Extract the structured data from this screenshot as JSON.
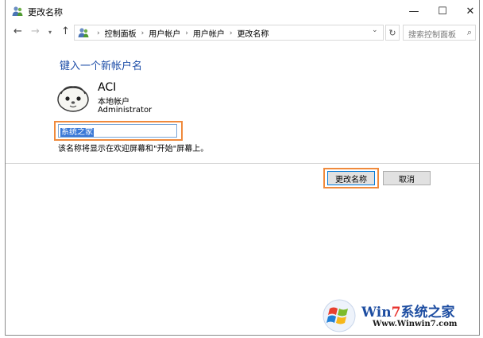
{
  "window": {
    "title": "更改名称",
    "controls": {
      "minimize": "—",
      "maximize": "☐",
      "close": "✕"
    }
  },
  "nav": {
    "back": "←",
    "forward": "→",
    "recent": "▾",
    "up": "↑",
    "breadcrumbs": [
      "控制面板",
      "用户帐户",
      "用户帐户",
      "更改名称"
    ],
    "separator": "›",
    "address_dropdown": "⌄",
    "refresh": "↻",
    "search_placeholder": "搜索控制面板",
    "search_icon": "⌕"
  },
  "content": {
    "heading": "键入一个新帐户名",
    "account": {
      "name": "ACI",
      "type": "本地帐户",
      "group": "Administrator"
    },
    "new_name_value": "系统之家",
    "hint": "该名称将显示在欢迎屏幕和\"开始\"屏幕上。"
  },
  "buttons": {
    "rename": "更改名称",
    "cancel": "取消"
  },
  "watermark": {
    "brand_part1": "Win",
    "brand_part2": "7",
    "brand_part3": "系统之家",
    "url": "Www.Winwin7.com"
  },
  "colors": {
    "heading": "#1e4ea8",
    "highlight": "#f08a3c",
    "selection": "#3a78d6",
    "accent": "#0078d7"
  },
  "icons": {
    "title": "users-icon",
    "address": "users-icon",
    "avatar": "user-avatar-icon",
    "watermark_logo": "windows-logo-icon"
  }
}
